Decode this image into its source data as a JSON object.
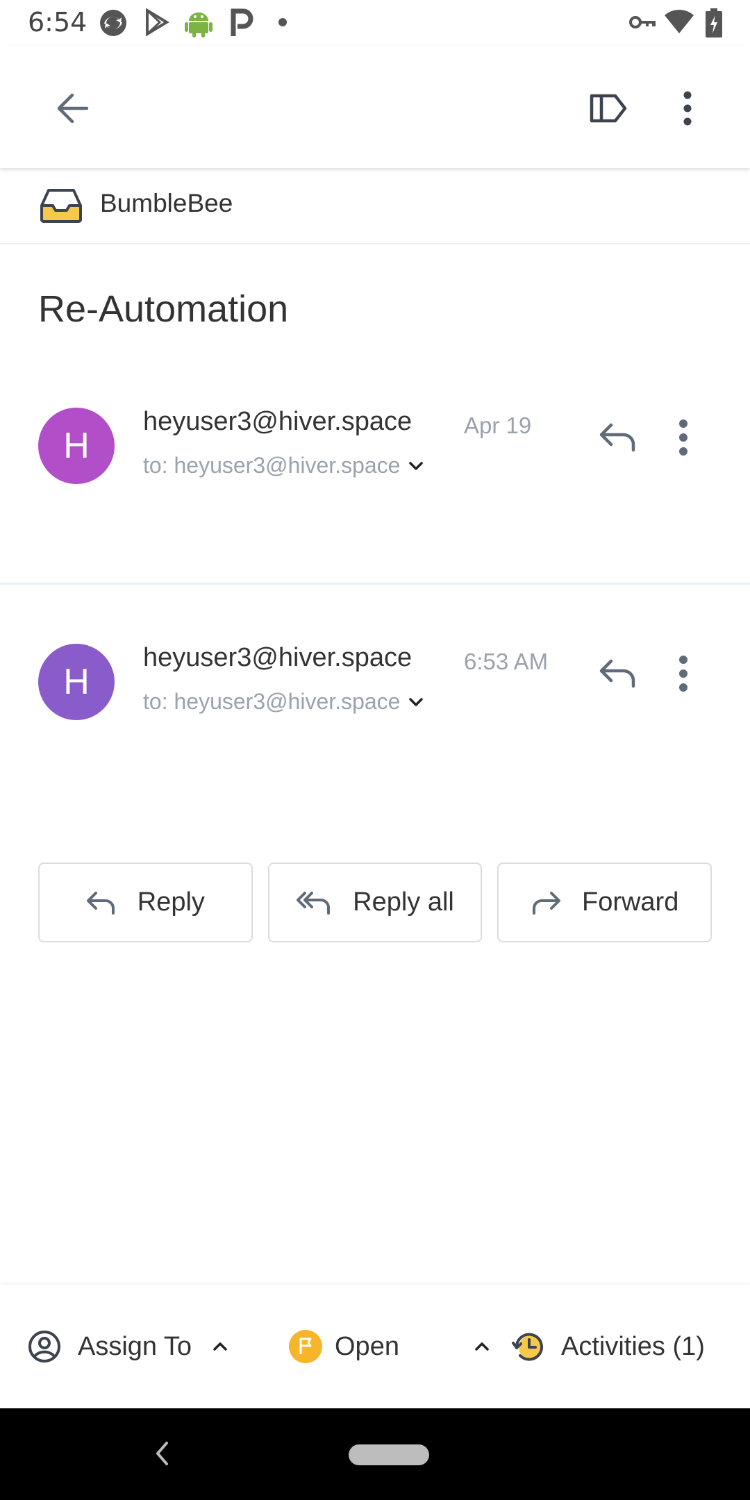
{
  "status_bar": {
    "time": "6:54",
    "icons": [
      "sync-icon",
      "play-store-icon",
      "android-icon",
      "p-icon",
      "dot-icon",
      "vpn-key-icon",
      "wifi-icon",
      "battery-charging-icon"
    ]
  },
  "app_bar": {
    "icons": [
      "back-arrow-icon",
      "label-icon",
      "more-vert-icon"
    ]
  },
  "inbox": {
    "name": "BumbleBee",
    "icon": "inbox-tray-icon",
    "icon_color": "#F7C948"
  },
  "thread": {
    "subject": "Re-Automation"
  },
  "messages": [
    {
      "avatar_letter": "H",
      "avatar_color": "#B24FC8",
      "sender": "heyuser3@hiver.space",
      "date": "Apr 19",
      "to_line": "to: heyuser3@hiver.space"
    },
    {
      "avatar_letter": "H",
      "avatar_color": "#8A5BCB",
      "sender": "heyuser3@hiver.space",
      "date": "6:53 AM",
      "to_line": "to: heyuser3@hiver.space"
    }
  ],
  "actions": {
    "reply": "Reply",
    "reply_all": "Reply all",
    "forward": "Forward"
  },
  "bottom_bar": {
    "assign": "Assign To",
    "status": "Open",
    "status_color": "#F7B52C",
    "activities": "Activities (1)"
  },
  "colors": {
    "accent_gray": "#5F6B7A",
    "secondary_text": "#9AA2AD"
  }
}
